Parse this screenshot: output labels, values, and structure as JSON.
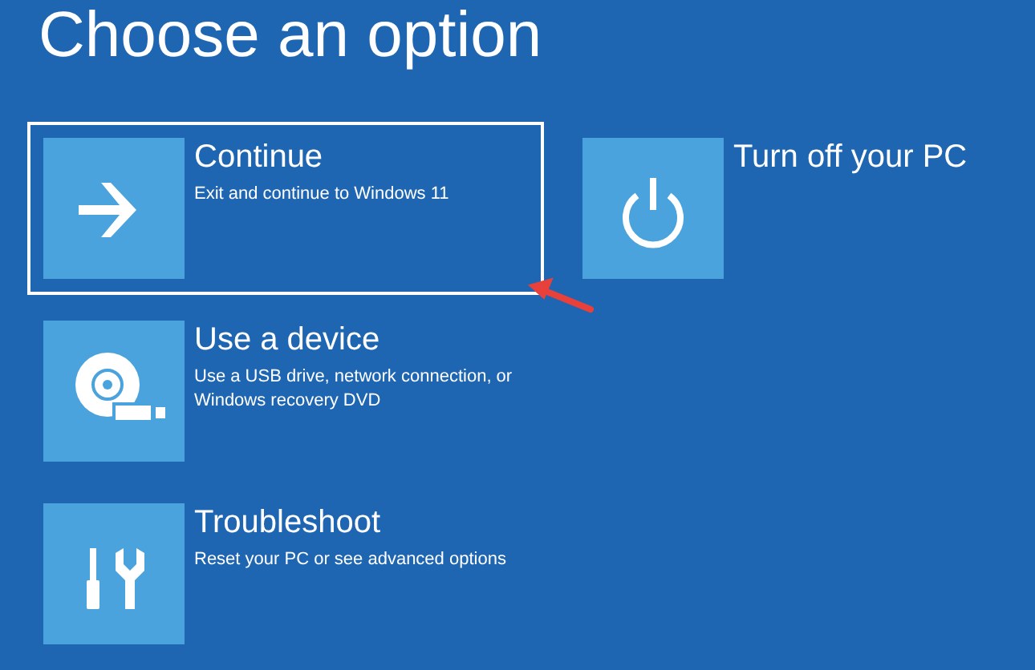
{
  "title": "Choose an option",
  "options": [
    {
      "kind": "arrow",
      "label": "Continue",
      "description": "Exit and continue to Windows 11",
      "selected": true
    },
    {
      "kind": "device",
      "label": "Use a device",
      "description": "Use a USB drive, network connection, or Windows recovery DVD",
      "selected": false
    },
    {
      "kind": "tools",
      "label": "Troubleshoot",
      "description": "Reset your PC or see advanced options",
      "selected": false
    },
    {
      "kind": "power",
      "label": "Turn off your PC",
      "selected": false
    }
  ]
}
